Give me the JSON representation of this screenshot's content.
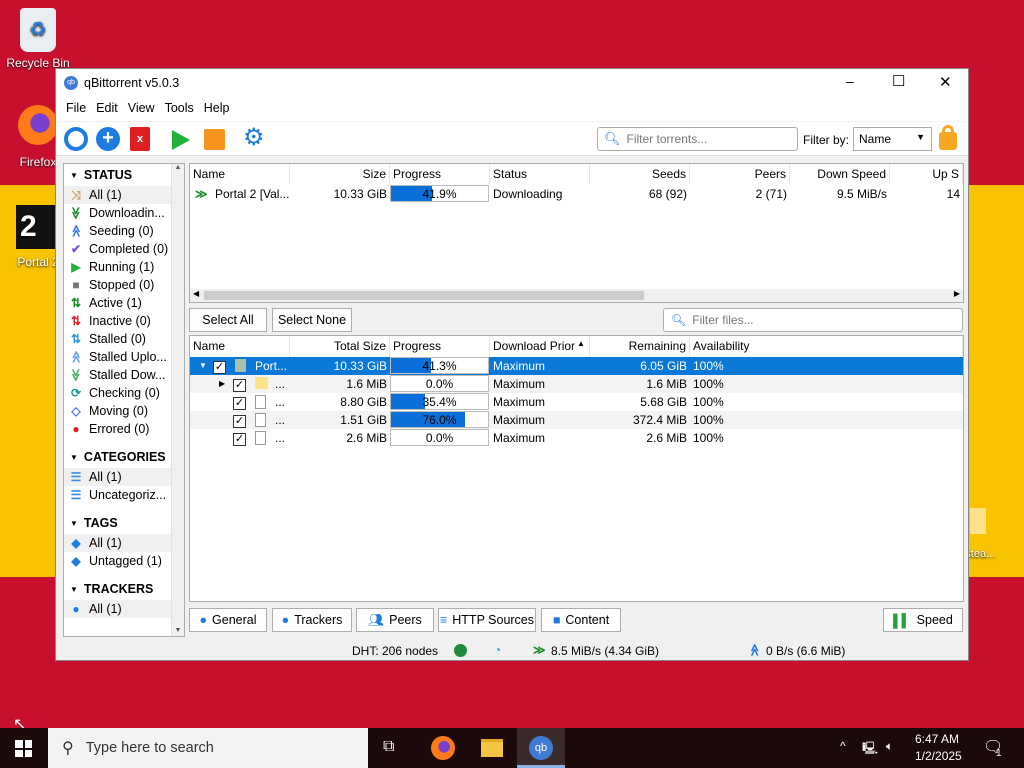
{
  "desktop": {
    "icons": [
      {
        "label": "Recycle Bin"
      },
      {
        "label": "Firefox"
      },
      {
        "label": "Portal 2"
      },
      {
        "label": "...estea..."
      }
    ]
  },
  "window": {
    "title": "qBittorrent v5.0.3",
    "controls": {
      "minimize": "–",
      "maximize": "☐",
      "close": "✕"
    }
  },
  "menu": [
    "File",
    "Edit",
    "View",
    "Tools",
    "Help"
  ],
  "toolbar": {
    "filter_placeholder": "Filter torrents...",
    "filter_by_label": "Filter by:",
    "filter_by_value": "Name"
  },
  "sidebar": {
    "status_title": "STATUS",
    "status": [
      {
        "label": "All (1)",
        "icon": "shuffle-icon"
      },
      {
        "label": "Downloadin...",
        "icon": "download-icon"
      },
      {
        "label": "Seeding (0)",
        "icon": "upload-icon"
      },
      {
        "label": "Completed (0)",
        "icon": "check-icon"
      },
      {
        "label": "Running (1)",
        "icon": "play-icon"
      },
      {
        "label": "Stopped (0)",
        "icon": "stop-icon"
      },
      {
        "label": "Active (1)",
        "icon": "active-icon"
      },
      {
        "label": "Inactive (0)",
        "icon": "inactive-icon"
      },
      {
        "label": "Stalled (0)",
        "icon": "stalled-icon"
      },
      {
        "label": "Stalled Uplo...",
        "icon": "stalled-upload-icon"
      },
      {
        "label": "Stalled Dow...",
        "icon": "stalled-download-icon"
      },
      {
        "label": "Checking (0)",
        "icon": "checking-icon"
      },
      {
        "label": "Moving (0)",
        "icon": "moving-icon"
      },
      {
        "label": "Errored (0)",
        "icon": "error-icon"
      }
    ],
    "categories_title": "CATEGORIES",
    "categories": [
      "All (1)",
      "Uncategoriz..."
    ],
    "tags_title": "TAGS",
    "tags": [
      "All (1)",
      "Untagged (1)"
    ],
    "trackers_title": "TRACKERS",
    "trackers": [
      "All (1)"
    ]
  },
  "torrents": {
    "columns": [
      "Name",
      "Size",
      "Progress",
      "Status",
      "Seeds",
      "Peers",
      "Down Speed",
      "Up S"
    ],
    "rows": [
      {
        "name": "Portal 2 [Val...",
        "size": "10.33 GiB",
        "progress": 0.419,
        "progress_text": "41.9%",
        "status": "Downloading",
        "seeds": "68 (92)",
        "peers": "2 (71)",
        "down": "9.5 MiB/s",
        "up": "14"
      }
    ]
  },
  "content": {
    "select_all": "Select All",
    "select_none": "Select None",
    "filter_placeholder": "Filter files...",
    "columns": [
      "Name",
      "Total Size",
      "Progress",
      "Download Prior",
      "Remaining",
      "Availability"
    ],
    "rows": [
      {
        "name": "Port...",
        "size": "10.33 GiB",
        "progress": 0.413,
        "progress_text": "41.3%",
        "priority": "Maximum",
        "remaining": "6.05 GiB",
        "availability": "100%"
      },
      {
        "name": "...",
        "size": "1.6 MiB",
        "progress": 0,
        "progress_text": "0.0%",
        "priority": "Maximum",
        "remaining": "1.6 MiB",
        "availability": "100%"
      },
      {
        "name": "...",
        "size": "8.80 GiB",
        "progress": 0.354,
        "progress_text": "35.4%",
        "priority": "Maximum",
        "remaining": "5.68 GiB",
        "availability": "100%"
      },
      {
        "name": "...",
        "size": "1.51 GiB",
        "progress": 0.76,
        "progress_text": "76.0%",
        "priority": "Maximum",
        "remaining": "372.4 MiB",
        "availability": "100%"
      },
      {
        "name": "...",
        "size": "2.6 MiB",
        "progress": 0,
        "progress_text": "0.0%",
        "priority": "Maximum",
        "remaining": "2.6 MiB",
        "availability": "100%"
      }
    ]
  },
  "tabs": [
    "General",
    "Trackers",
    "Peers",
    "HTTP Sources",
    "Content"
  ],
  "speed_button": "Speed",
  "statusbar": {
    "dht": "DHT: 206 nodes",
    "down": "8.5 MiB/s (4.34 GiB)",
    "up": "0 B/s (6.6 MiB)"
  },
  "taskbar": {
    "search_placeholder": "Type here to search",
    "time": "6:47 AM",
    "date": "1/2/2025",
    "notifications": "1"
  }
}
